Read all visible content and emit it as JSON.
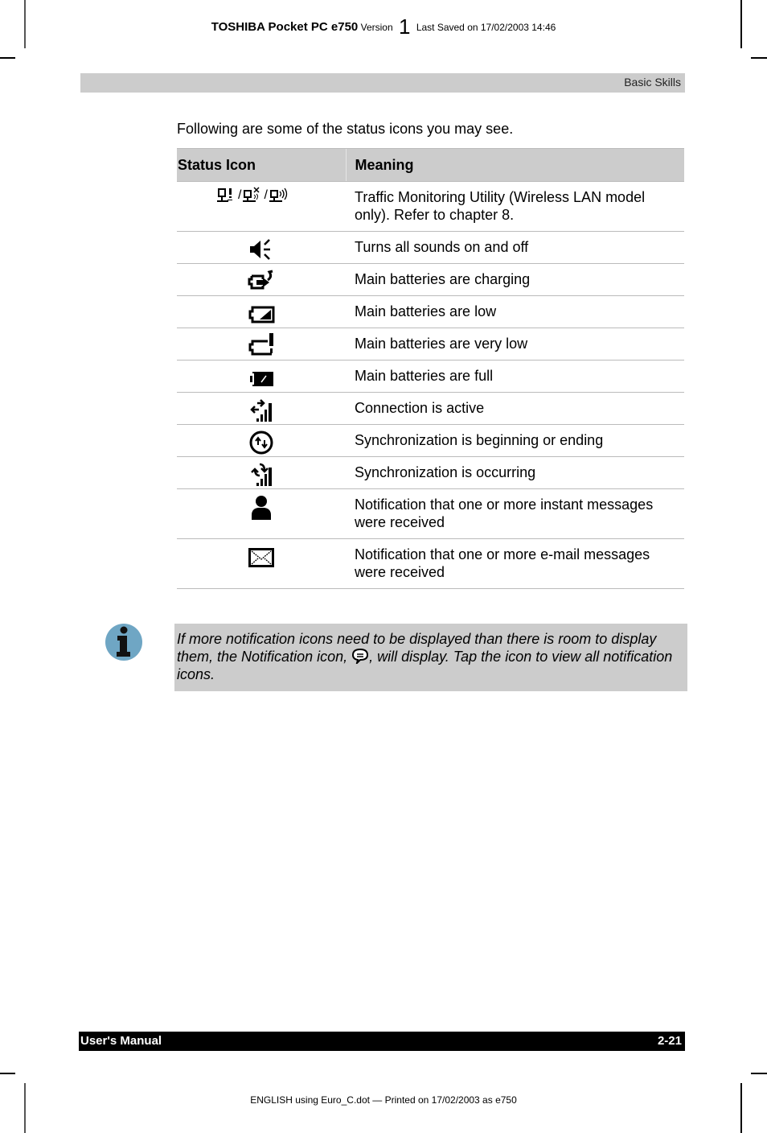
{
  "header": {
    "brand": "TOSHIBA Pocket PC e750",
    "version_label": "Version",
    "version_number": "1",
    "last_saved": "Last Saved on 17/02/2003 14:46"
  },
  "section": {
    "title": "Basic Skills"
  },
  "intro": "Following are some of the status icons you may see.",
  "table": {
    "headers": [
      "Status Icon",
      "Meaning"
    ],
    "separator": "/",
    "rows": [
      {
        "icon": "traffic-monitoring-icons",
        "meaning": "Traffic Monitoring Utility (Wireless LAN model only). Refer to chapter 8."
      },
      {
        "icon": "speaker-icon",
        "meaning": "Turns all sounds on and off"
      },
      {
        "icon": "battery-charging-icon",
        "meaning": "Main batteries are charging"
      },
      {
        "icon": "battery-low-icon",
        "meaning": "Main batteries are low"
      },
      {
        "icon": "battery-very-low-icon",
        "meaning": "Main batteries are very low"
      },
      {
        "icon": "battery-full-icon",
        "meaning": "Main batteries are full"
      },
      {
        "icon": "connection-active-icon",
        "meaning": "Connection is active"
      },
      {
        "icon": "sync-begin-end-icon",
        "meaning": "Synchronization is beginning or ending"
      },
      {
        "icon": "sync-occurring-icon",
        "meaning": "Synchronization is occurring"
      },
      {
        "icon": "instant-message-icon",
        "meaning": "Notification that one or more instant messages were received"
      },
      {
        "icon": "email-icon",
        "meaning": "Notification that one or more e-mail messages were received"
      }
    ]
  },
  "note": {
    "text_before": "If more notification icons need to be displayed than there is room to display them, the Notification icon, ",
    "text_after": ", will display. Tap the icon to view all notification icons."
  },
  "footer": {
    "left": "User's Manual",
    "right": "2-21",
    "print_info": "ENGLISH using Euro_C.dot — Printed on 17/02/2003 as e750"
  }
}
